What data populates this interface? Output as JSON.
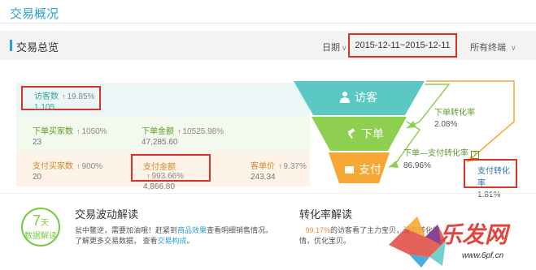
{
  "page": {
    "title": "交易概况"
  },
  "toolbar": {
    "section": "交易总览",
    "date_label": "日期",
    "date_range": "2015-12-11~2015-12-11",
    "terminal": "所有终端",
    "caret": "∨"
  },
  "metrics": {
    "visitors": {
      "label": "访客数",
      "change": "19.85%",
      "value": "1,105"
    },
    "order_buyers": {
      "label": "下单买家数",
      "change": "1050%",
      "value": "23"
    },
    "order_amount": {
      "label": "下单金额",
      "change": "10525.98%",
      "value": "47,285.60"
    },
    "pay_buyers": {
      "label": "支付买家数",
      "change": "900%",
      "value": "20"
    },
    "pay_amount": {
      "label": "支付金额",
      "change": "993.66%",
      "value": "4,866.80"
    },
    "unit_price": {
      "label": "客单价",
      "change": "9.37%",
      "value": "243.34"
    },
    "up_arrow": "↑"
  },
  "funnel": {
    "visit": "访客",
    "order": "下单",
    "pay": "支付",
    "colors": {
      "visit": "#5cc8c4",
      "order": "#8fcf4f",
      "pay": "#f7a733"
    }
  },
  "rates": {
    "order_rate": {
      "label": "下单转化率",
      "value": "2.08%"
    },
    "order_pay_rate": {
      "label": "下单—支付转化率",
      "value": "86.96%"
    },
    "pay_rate": {
      "label": "支付转化率",
      "value": "1.81%"
    }
  },
  "analysis": {
    "badge_num": "7",
    "badge_unit": "天",
    "badge_text": "数据解读",
    "wave_title": "交易波动解读",
    "wave_line1_pre": "瓮中鳖逆，需要加油哦！赶紧到",
    "wave_link1": "商品效果",
    "wave_line1_post": "查看明细销售情况。",
    "wave_line2_pre": "了解更多交易数据，  查看",
    "wave_link2": "交易构成",
    "wave_line2_post": "。",
    "conv_title": "转化率解读",
    "conv_pct": "99.17%",
    "conv_line1": "的访客看了主力宝贝，没有转化掉",
    "conv_line2": "情，优化宝贝。"
  },
  "watermark": {
    "text": "乐发网",
    "url": "www.6pf.cn"
  }
}
